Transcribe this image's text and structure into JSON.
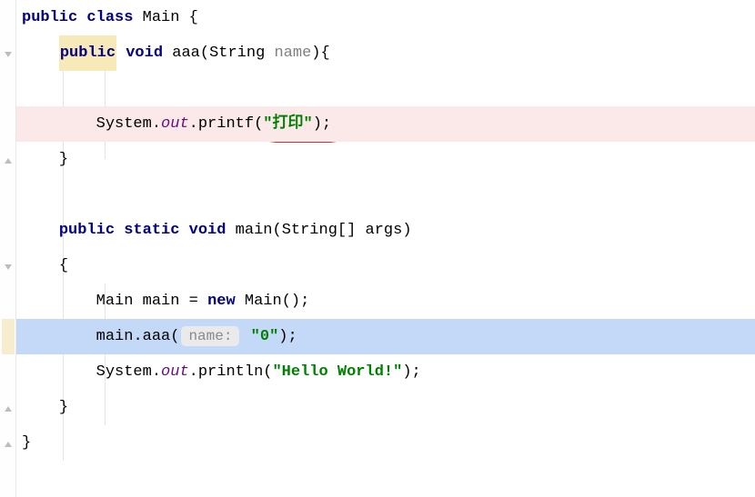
{
  "code": {
    "l1": {
      "kw1": "public",
      "kw2": "class",
      "cls": "Main",
      "brace": "{"
    },
    "l2": {
      "kw1": "public",
      "kw2": "void",
      "method": "aaa",
      "lp": "(",
      "ptype": "String",
      "pname": "name",
      "rpb": "){"
    },
    "l4": {
      "sys": "System",
      "d1": ".",
      "out": "out",
      "d2": ".",
      "method": "printf",
      "lp": "(",
      "str": "\"打印\"",
      "rpe": ")",
      "semi": ";"
    },
    "l5": {
      "brace": "}"
    },
    "l7": {
      "kw1": "public",
      "kw2": "static",
      "kw3": "void",
      "method": "main",
      "lp": "(",
      "ptype": "String",
      "arr": "[]",
      "pname": "args",
      "rp": ")"
    },
    "l8": {
      "brace": "{"
    },
    "l9": {
      "type": "Main",
      "var": "main",
      "eq": "=",
      "kw": "new",
      "ctor": "Main",
      "call": "()",
      "semi": ";"
    },
    "l10": {
      "obj": "main",
      "d1": ".",
      "method": "aaa",
      "lp": "(",
      "hint": "name:",
      "arg": "\"0\"",
      "rp": ")",
      "semi": ";"
    },
    "l11": {
      "sys": "System",
      "d1": ".",
      "out": "out",
      "d2": ".",
      "method": "println",
      "lp": "(",
      "str": "\"Hello World!\"",
      "rp": ")",
      "semi": ";"
    },
    "l12": {
      "brace": "}"
    },
    "l13": {
      "brace": "}"
    }
  }
}
